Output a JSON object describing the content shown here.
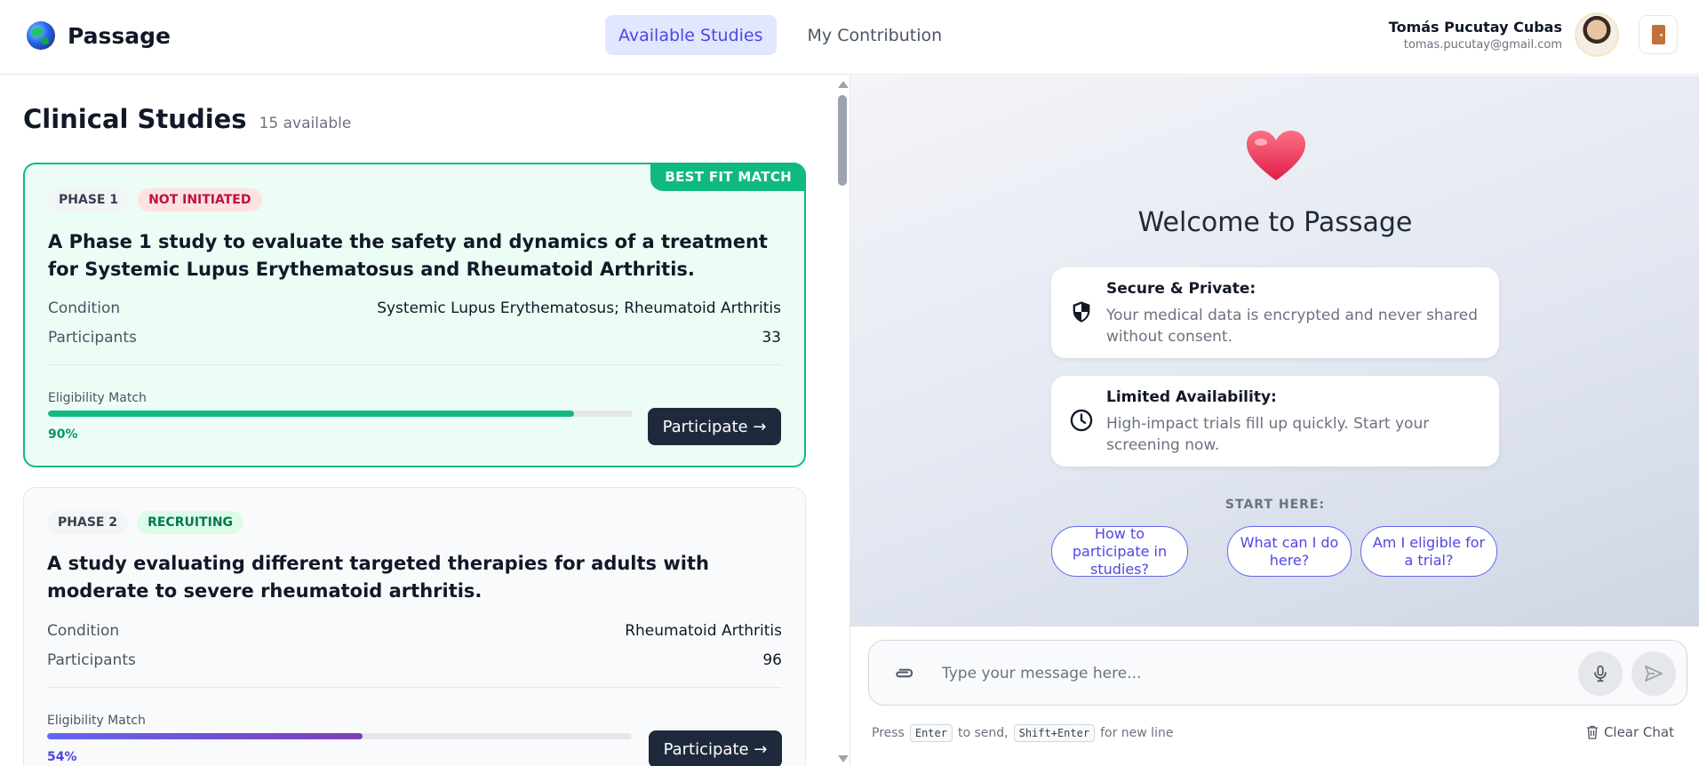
{
  "app": {
    "name": "Passage"
  },
  "nav": {
    "tabs": [
      {
        "label": "Available Studies",
        "active": true
      },
      {
        "label": "My Contribution",
        "active": false
      }
    ]
  },
  "user": {
    "name": "Tomás Pucutay Cubas",
    "email": "tomas.pucutay@gmail.com"
  },
  "studies": {
    "title": "Clinical Studies",
    "count_label": "15 available",
    "cards": [
      {
        "ribbon": "BEST FIT MATCH",
        "phase": "PHASE 1",
        "status": "NOT INITIATED",
        "title": "A Phase 1 study to evaluate the safety and dynamics of a treatment for Systemic Lupus Erythematosus and Rheumatoid Arthritis.",
        "condition_label": "Condition",
        "condition": "Systemic Lupus Erythematosus; Rheumatoid Arthritis",
        "participants_label": "Participants",
        "participants": "33",
        "eligibility_label": "Eligibility Match",
        "eligibility_pct": "90%",
        "eligibility_value": 0.9,
        "action": "Participate →"
      },
      {
        "phase": "PHASE 2",
        "status": "RECRUITING",
        "title": "A study evaluating different targeted therapies for adults with moderate to severe rheumatoid arthritis.",
        "condition_label": "Condition",
        "condition": "Rheumatoid Arthritis",
        "participants_label": "Participants",
        "participants": "96",
        "eligibility_label": "Eligibility Match",
        "eligibility_pct": "54%",
        "eligibility_value": 0.54,
        "action": "Participate →"
      }
    ]
  },
  "chat": {
    "welcome": "Welcome to Passage",
    "info": [
      {
        "title": "Secure & Private:",
        "text": "Your medical data is encrypted and never shared without consent.",
        "icon": "shield-icon"
      },
      {
        "title": "Limited Availability:",
        "text": "High-impact trials fill up quickly. Start your screening now.",
        "icon": "clock-icon"
      }
    ],
    "start_here": "START HERE:",
    "suggestions": [
      "How to participate in studies?",
      "What can I do here?",
      "Am I eligible for a trial?"
    ],
    "input_placeholder": "Type your message here...",
    "hint_press": "Press",
    "hint_enter": "Enter",
    "hint_to_send": "to send,",
    "hint_shift": "Shift+Enter",
    "hint_newline": "for new line",
    "clear_chat": "Clear Chat"
  },
  "colors": {
    "accent": "#4f46e5",
    "success": "#10b981",
    "dark": "#1e293b"
  }
}
